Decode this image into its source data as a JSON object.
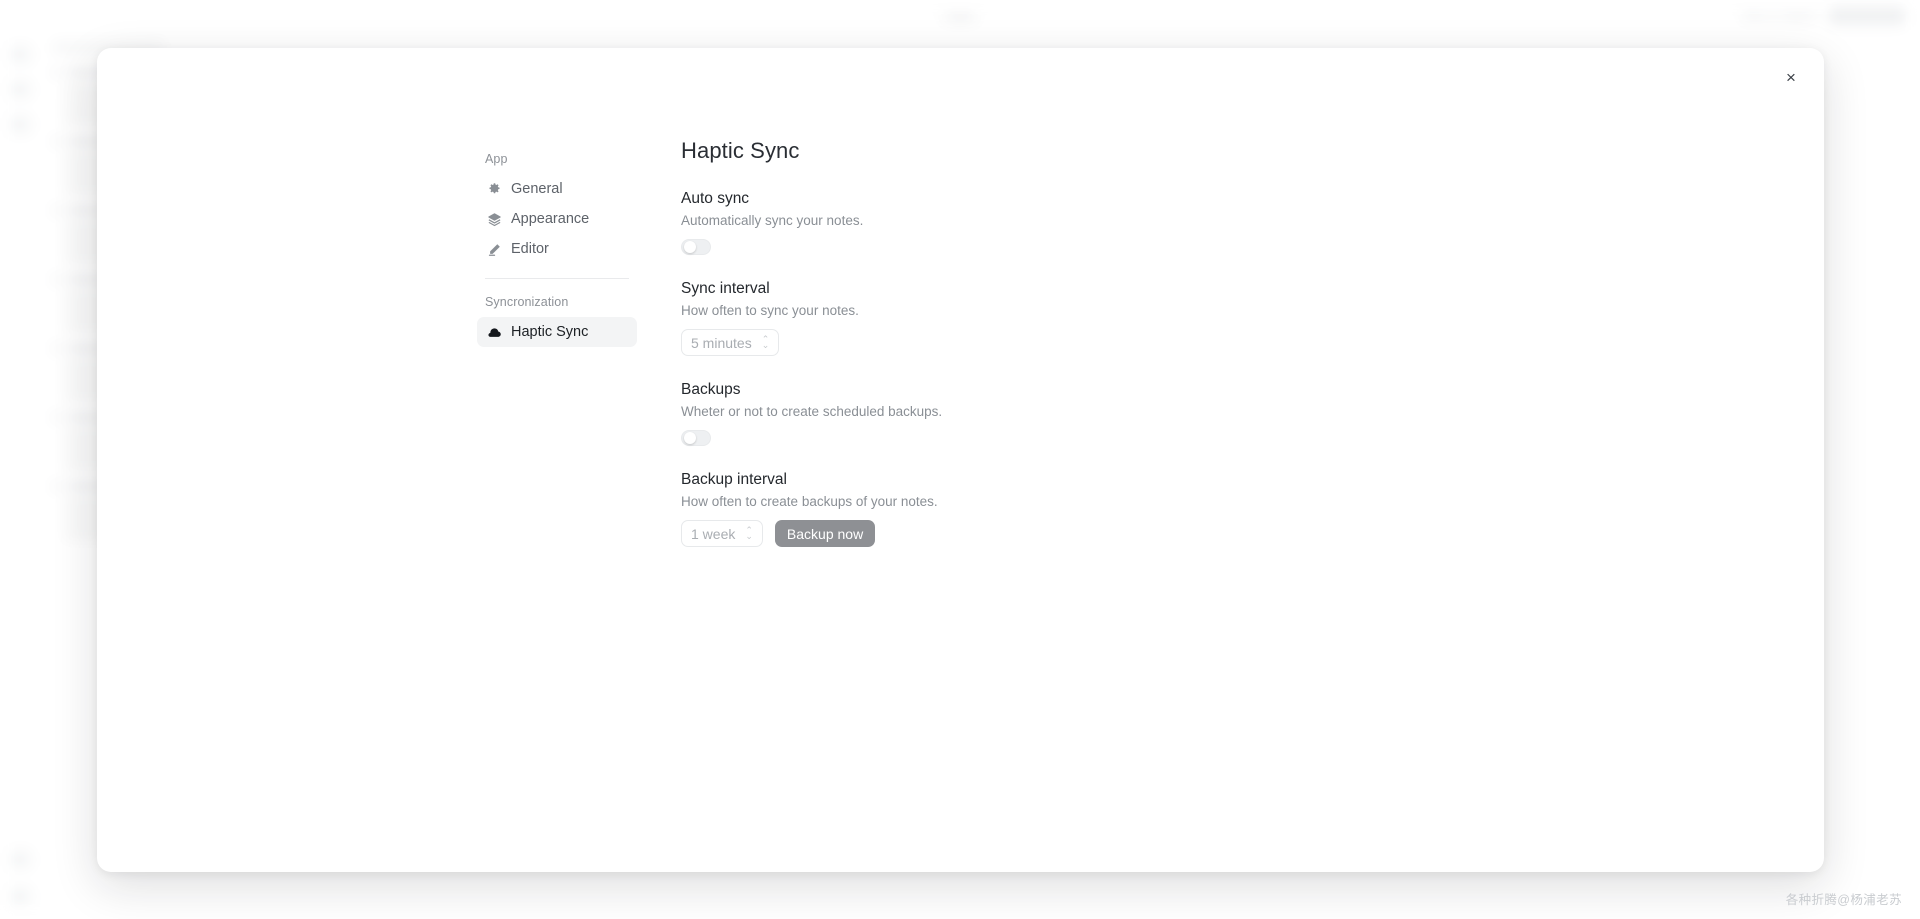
{
  "background_app": {
    "topbar_title": "Haptic",
    "topbar_link": "New to Haptic?",
    "accent_color": "#8e9094"
  },
  "modal": {
    "close_label": "×",
    "nav": {
      "sections": [
        {
          "label": "App",
          "items": [
            {
              "label": "General",
              "icon": "gear-icon",
              "selected": false
            },
            {
              "label": "Appearance",
              "icon": "palette-icon",
              "selected": false
            },
            {
              "label": "Editor",
              "icon": "pencil-icon",
              "selected": false
            }
          ]
        },
        {
          "label": "Syncronization",
          "items": [
            {
              "label": "Haptic Sync",
              "icon": "cloud-icon",
              "selected": true
            }
          ]
        }
      ]
    },
    "content": {
      "title": "Haptic Sync",
      "settings": [
        {
          "title": "Auto sync",
          "description": "Automatically sync your notes.",
          "control": "toggle",
          "toggle_state": "off"
        },
        {
          "title": "Sync interval",
          "description": "How often to sync your notes.",
          "control": "select",
          "select_value": "5 minutes",
          "select_disabled": true
        },
        {
          "title": "Backups",
          "description": "Wheter or not to create scheduled backups.",
          "control": "toggle",
          "toggle_state": "off"
        },
        {
          "title": "Backup interval",
          "description": "How often to create backups of your notes.",
          "control": "select-with-button",
          "select_value": "1 week",
          "select_disabled": true,
          "button_label": "Backup now"
        }
      ]
    }
  },
  "watermark": {
    "text": "各种折腾@杨浦老苏"
  }
}
